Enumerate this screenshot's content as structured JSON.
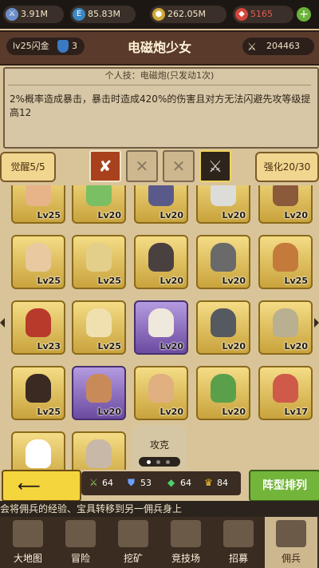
{
  "resources": [
    {
      "icon": "sword-icon",
      "value": "3.91M",
      "color": "#6b8ec9"
    },
    {
      "icon": "energy-icon",
      "value": "85.83M",
      "color": "#3a87c4"
    },
    {
      "icon": "coin-icon",
      "value": "262.05M",
      "color": "#d2a83a"
    },
    {
      "icon": "ruby-icon",
      "value": "5165",
      "color": "#d2453b"
    }
  ],
  "header": {
    "title": "电磁炮少女",
    "rank": "lv25闪金",
    "shield_count": "3",
    "power": "204463"
  },
  "skill": {
    "heading": "个人技：电磁炮(只发动1次)",
    "description": "2%概率造成暴击，暴击时造成420%的伤害且对方无法闪避先攻等级提高12"
  },
  "tabs": {
    "awaken": "觉醒5/5",
    "enhance": "强化20/30"
  },
  "grid": [
    {
      "level": "Lv25",
      "color": "gold"
    },
    {
      "level": "Lv20",
      "color": "gold"
    },
    {
      "level": "Lv20",
      "color": "gold"
    },
    {
      "level": "Lv20",
      "color": "gold"
    },
    {
      "level": "Lv20",
      "color": "gold"
    },
    {
      "level": "Lv25",
      "color": "gold"
    },
    {
      "level": "Lv25",
      "color": "gold"
    },
    {
      "level": "Lv20",
      "color": "gold"
    },
    {
      "level": "Lv20",
      "color": "gold"
    },
    {
      "level": "Lv25",
      "color": "gold"
    },
    {
      "level": "Lv23",
      "color": "gold"
    },
    {
      "level": "Lv25",
      "color": "gold"
    },
    {
      "level": "Lv20",
      "color": "purple"
    },
    {
      "level": "Lv20",
      "color": "gold"
    },
    {
      "level": "Lv20",
      "color": "gold"
    },
    {
      "level": "Lv25",
      "color": "gold"
    },
    {
      "level": "Lv20",
      "color": "purple"
    },
    {
      "level": "Lv20",
      "color": "gold"
    },
    {
      "level": "Lv20",
      "color": "gold"
    },
    {
      "level": "Lv17",
      "color": "gold"
    },
    {
      "level": "",
      "color": "gold"
    },
    {
      "level": "",
      "color": "gold"
    }
  ],
  "bottom_tab_label": "攻克",
  "counts": [
    {
      "icon": "sword-count-icon",
      "value": "64"
    },
    {
      "icon": "shield-count-icon",
      "value": "53"
    },
    {
      "icon": "gem-count-icon",
      "value": "64"
    },
    {
      "icon": "crown-count-icon",
      "value": "84"
    }
  ],
  "formation_label": "阵型排列",
  "ticker": "会将佣兵的经验、宝具转移到另一佣兵身上",
  "nav": [
    {
      "label": "大地图",
      "icon": "map-icon"
    },
    {
      "label": "冒险",
      "icon": "adventure-icon"
    },
    {
      "label": "挖矿",
      "icon": "pickaxe-icon"
    },
    {
      "label": "竞技场",
      "icon": "swords-icon"
    },
    {
      "label": "招募",
      "icon": "recruit-icon"
    },
    {
      "label": "佣兵",
      "icon": "mercenary-icon"
    }
  ]
}
